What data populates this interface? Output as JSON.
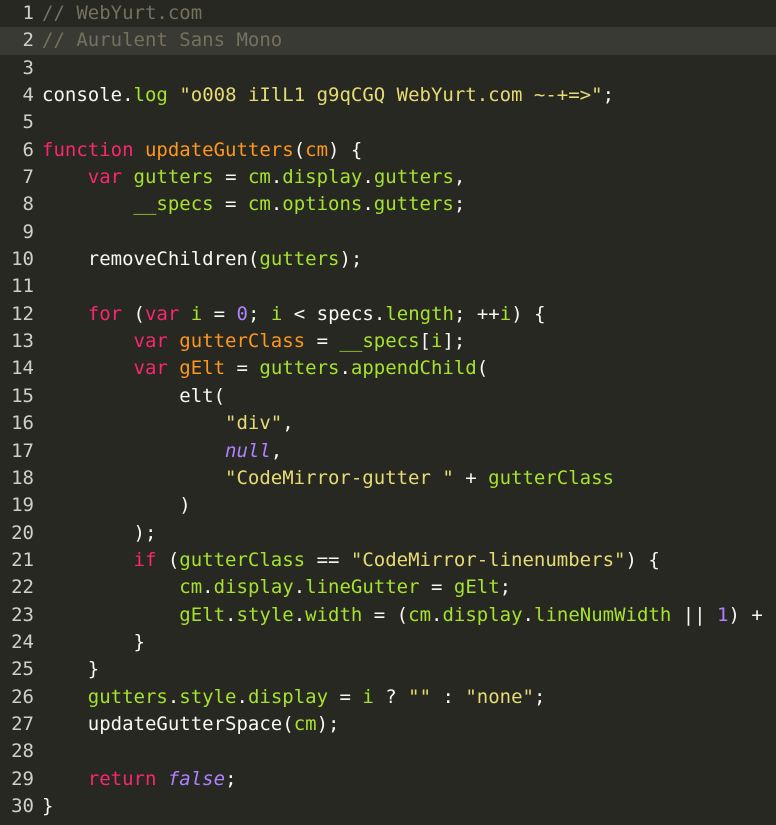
{
  "editor": {
    "theme": "monokai",
    "colors": {
      "background": "#272822",
      "active_line": "#3a3a35",
      "gutter_text": "#d0d0c8",
      "comment": "#75715e",
      "keyword": "#f92672",
      "def": "#fd971f",
      "variable": "#a6e22e",
      "number": "#ae81ff",
      "string": "#e6db74",
      "text": "#f8f8f2"
    },
    "lines": [
      {
        "n": "1",
        "tokens": [
          {
            "t": "// WebYurt.com",
            "c": "comment"
          }
        ]
      },
      {
        "n": "2",
        "active": true,
        "tokens": [
          {
            "t": "// Aurulent Sans Mono",
            "c": "comment"
          }
        ]
      },
      {
        "n": "3",
        "tokens": []
      },
      {
        "n": "4",
        "tokens": [
          {
            "t": "console",
            "c": "plain"
          },
          {
            "t": ".",
            "c": "punct"
          },
          {
            "t": "log",
            "c": "property"
          },
          {
            "t": " ",
            "c": "plain"
          },
          {
            "t": "\"o008 iIlL1 g9qCGQ WebYurt.com ~-+=>\"",
            "c": "string"
          },
          {
            "t": ";",
            "c": "punct"
          }
        ]
      },
      {
        "n": "5",
        "tokens": []
      },
      {
        "n": "6",
        "tokens": [
          {
            "t": "function",
            "c": "keyword"
          },
          {
            "t": " ",
            "c": "plain"
          },
          {
            "t": "updateGutters",
            "c": "def"
          },
          {
            "t": "(",
            "c": "punct"
          },
          {
            "t": "cm",
            "c": "def"
          },
          {
            "t": ") {",
            "c": "punct"
          }
        ]
      },
      {
        "n": "7",
        "tokens": [
          {
            "t": "    ",
            "c": "plain"
          },
          {
            "t": "var",
            "c": "keyword"
          },
          {
            "t": " ",
            "c": "plain"
          },
          {
            "t": "gutters",
            "c": "variable"
          },
          {
            "t": " = ",
            "c": "operator"
          },
          {
            "t": "cm",
            "c": "variable"
          },
          {
            "t": ".",
            "c": "punct"
          },
          {
            "t": "display",
            "c": "property"
          },
          {
            "t": ".",
            "c": "punct"
          },
          {
            "t": "gutters",
            "c": "property"
          },
          {
            "t": ",",
            "c": "punct"
          }
        ]
      },
      {
        "n": "8",
        "tokens": [
          {
            "t": "        ",
            "c": "plain"
          },
          {
            "t": "__specs",
            "c": "variable"
          },
          {
            "t": " = ",
            "c": "operator"
          },
          {
            "t": "cm",
            "c": "variable"
          },
          {
            "t": ".",
            "c": "punct"
          },
          {
            "t": "options",
            "c": "property"
          },
          {
            "t": ".",
            "c": "punct"
          },
          {
            "t": "gutters",
            "c": "property"
          },
          {
            "t": ";",
            "c": "punct"
          }
        ]
      },
      {
        "n": "9",
        "tokens": []
      },
      {
        "n": "10",
        "tokens": [
          {
            "t": "    ",
            "c": "plain"
          },
          {
            "t": "removeChildren",
            "c": "plain"
          },
          {
            "t": "(",
            "c": "punct"
          },
          {
            "t": "gutters",
            "c": "variable"
          },
          {
            "t": ");",
            "c": "punct"
          }
        ]
      },
      {
        "n": "11",
        "tokens": []
      },
      {
        "n": "12",
        "tokens": [
          {
            "t": "    ",
            "c": "plain"
          },
          {
            "t": "for",
            "c": "keyword"
          },
          {
            "t": " (",
            "c": "punct"
          },
          {
            "t": "var",
            "c": "keyword"
          },
          {
            "t": " ",
            "c": "plain"
          },
          {
            "t": "i",
            "c": "variable"
          },
          {
            "t": " = ",
            "c": "operator"
          },
          {
            "t": "0",
            "c": "number"
          },
          {
            "t": "; ",
            "c": "punct"
          },
          {
            "t": "i",
            "c": "variable"
          },
          {
            "t": " < ",
            "c": "operator"
          },
          {
            "t": "specs",
            "c": "plain"
          },
          {
            "t": ".",
            "c": "punct"
          },
          {
            "t": "length",
            "c": "property"
          },
          {
            "t": "; ++",
            "c": "punct"
          },
          {
            "t": "i",
            "c": "variable"
          },
          {
            "t": ") {",
            "c": "punct"
          }
        ]
      },
      {
        "n": "13",
        "tokens": [
          {
            "t": "        ",
            "c": "plain"
          },
          {
            "t": "var",
            "c": "keyword"
          },
          {
            "t": " ",
            "c": "plain"
          },
          {
            "t": "gutterClass",
            "c": "def"
          },
          {
            "t": " = ",
            "c": "operator"
          },
          {
            "t": "__specs",
            "c": "variable"
          },
          {
            "t": "[",
            "c": "punct"
          },
          {
            "t": "i",
            "c": "variable"
          },
          {
            "t": "];",
            "c": "punct"
          }
        ]
      },
      {
        "n": "14",
        "tokens": [
          {
            "t": "        ",
            "c": "plain"
          },
          {
            "t": "var",
            "c": "keyword"
          },
          {
            "t": " ",
            "c": "plain"
          },
          {
            "t": "gElt",
            "c": "def"
          },
          {
            "t": " = ",
            "c": "operator"
          },
          {
            "t": "gutters",
            "c": "variable"
          },
          {
            "t": ".",
            "c": "punct"
          },
          {
            "t": "appendChild",
            "c": "property"
          },
          {
            "t": "(",
            "c": "punct"
          }
        ]
      },
      {
        "n": "15",
        "tokens": [
          {
            "t": "            ",
            "c": "plain"
          },
          {
            "t": "elt",
            "c": "plain"
          },
          {
            "t": "(",
            "c": "punct"
          }
        ]
      },
      {
        "n": "16",
        "tokens": [
          {
            "t": "                ",
            "c": "plain"
          },
          {
            "t": "\"div\"",
            "c": "string"
          },
          {
            "t": ",",
            "c": "punct"
          }
        ]
      },
      {
        "n": "17",
        "tokens": [
          {
            "t": "                ",
            "c": "plain"
          },
          {
            "t": "null",
            "c": "atom"
          },
          {
            "t": ",",
            "c": "punct"
          }
        ]
      },
      {
        "n": "18",
        "tokens": [
          {
            "t": "                ",
            "c": "plain"
          },
          {
            "t": "\"CodeMirror-gutter \"",
            "c": "string"
          },
          {
            "t": " + ",
            "c": "operator"
          },
          {
            "t": "gutterClass",
            "c": "variable"
          }
        ]
      },
      {
        "n": "19",
        "tokens": [
          {
            "t": "            ",
            "c": "plain"
          },
          {
            "t": ")",
            "c": "punct"
          }
        ]
      },
      {
        "n": "20",
        "tokens": [
          {
            "t": "        ",
            "c": "plain"
          },
          {
            "t": ");",
            "c": "punct"
          }
        ]
      },
      {
        "n": "21",
        "tokens": [
          {
            "t": "        ",
            "c": "plain"
          },
          {
            "t": "if",
            "c": "keyword"
          },
          {
            "t": " (",
            "c": "punct"
          },
          {
            "t": "gutterClass",
            "c": "variable"
          },
          {
            "t": " == ",
            "c": "operator"
          },
          {
            "t": "\"CodeMirror-linenumbers\"",
            "c": "string"
          },
          {
            "t": ") {",
            "c": "punct"
          }
        ]
      },
      {
        "n": "22",
        "tokens": [
          {
            "t": "            ",
            "c": "plain"
          },
          {
            "t": "cm",
            "c": "variable"
          },
          {
            "t": ".",
            "c": "punct"
          },
          {
            "t": "display",
            "c": "property"
          },
          {
            "t": ".",
            "c": "punct"
          },
          {
            "t": "lineGutter",
            "c": "property"
          },
          {
            "t": " = ",
            "c": "operator"
          },
          {
            "t": "gElt",
            "c": "variable"
          },
          {
            "t": ";",
            "c": "punct"
          }
        ]
      },
      {
        "n": "23",
        "tokens": [
          {
            "t": "            ",
            "c": "plain"
          },
          {
            "t": "gElt",
            "c": "variable"
          },
          {
            "t": ".",
            "c": "punct"
          },
          {
            "t": "style",
            "c": "property"
          },
          {
            "t": ".",
            "c": "punct"
          },
          {
            "t": "width",
            "c": "property"
          },
          {
            "t": " = (",
            "c": "operator"
          },
          {
            "t": "cm",
            "c": "variable"
          },
          {
            "t": ".",
            "c": "punct"
          },
          {
            "t": "display",
            "c": "property"
          },
          {
            "t": ".",
            "c": "punct"
          },
          {
            "t": "lineNumWidth",
            "c": "property"
          },
          {
            "t": " || ",
            "c": "operator"
          },
          {
            "t": "1",
            "c": "number"
          },
          {
            "t": ") +",
            "c": "punct"
          }
        ]
      },
      {
        "n": "24",
        "tokens": [
          {
            "t": "        ",
            "c": "plain"
          },
          {
            "t": "}",
            "c": "punct"
          }
        ]
      },
      {
        "n": "25",
        "tokens": [
          {
            "t": "    ",
            "c": "plain"
          },
          {
            "t": "}",
            "c": "punct"
          }
        ]
      },
      {
        "n": "26",
        "tokens": [
          {
            "t": "    ",
            "c": "plain"
          },
          {
            "t": "gutters",
            "c": "variable"
          },
          {
            "t": ".",
            "c": "punct"
          },
          {
            "t": "style",
            "c": "property"
          },
          {
            "t": ".",
            "c": "punct"
          },
          {
            "t": "display",
            "c": "property"
          },
          {
            "t": " = ",
            "c": "operator"
          },
          {
            "t": "i",
            "c": "variable"
          },
          {
            "t": " ? ",
            "c": "operator"
          },
          {
            "t": "\"\"",
            "c": "string"
          },
          {
            "t": " : ",
            "c": "operator"
          },
          {
            "t": "\"none\"",
            "c": "string"
          },
          {
            "t": ";",
            "c": "punct"
          }
        ]
      },
      {
        "n": "27",
        "tokens": [
          {
            "t": "    ",
            "c": "plain"
          },
          {
            "t": "updateGutterSpace",
            "c": "plain"
          },
          {
            "t": "(",
            "c": "punct"
          },
          {
            "t": "cm",
            "c": "variable"
          },
          {
            "t": ");",
            "c": "punct"
          }
        ]
      },
      {
        "n": "28",
        "tokens": []
      },
      {
        "n": "29",
        "tokens": [
          {
            "t": "    ",
            "c": "plain"
          },
          {
            "t": "return",
            "c": "keyword"
          },
          {
            "t": " ",
            "c": "plain"
          },
          {
            "t": "false",
            "c": "atom"
          },
          {
            "t": ";",
            "c": "punct"
          }
        ]
      },
      {
        "n": "30",
        "tokens": [
          {
            "t": "}",
            "c": "punct"
          }
        ]
      }
    ]
  }
}
